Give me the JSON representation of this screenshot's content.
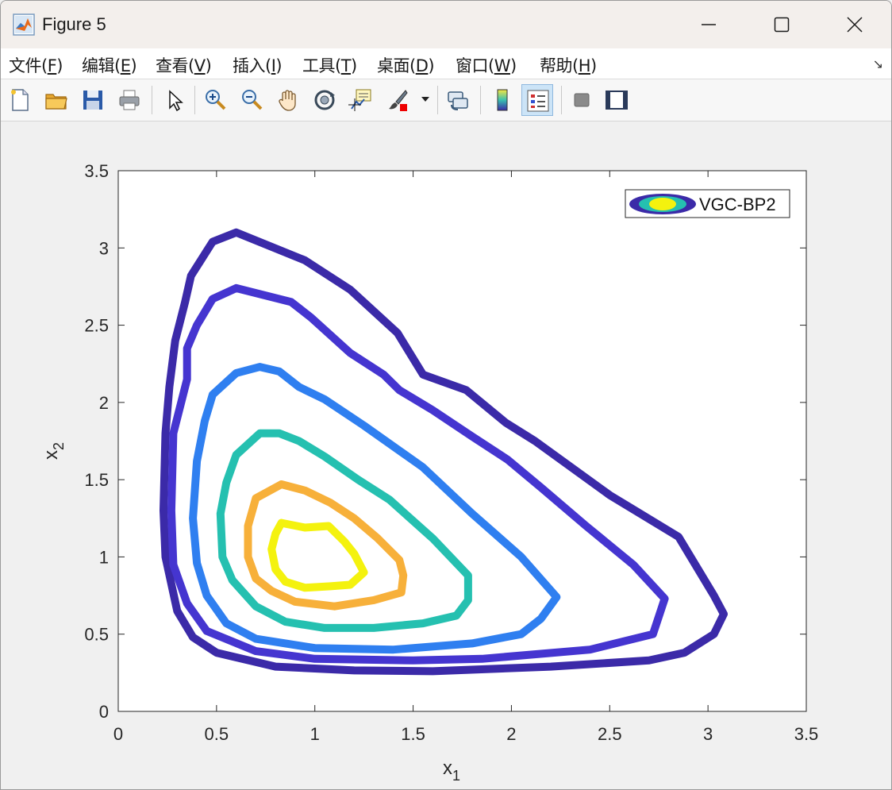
{
  "window": {
    "title": "Figure 5"
  },
  "menu": {
    "items": [
      {
        "label": "文件(",
        "key": "F",
        "tail": ")"
      },
      {
        "label": "编辑(",
        "key": "E",
        "tail": ")"
      },
      {
        "label": "查看(",
        "key": "V",
        "tail": ")"
      },
      {
        "label": "插入(",
        "key": "I",
        "tail": ")"
      },
      {
        "label": "工具(",
        "key": "T",
        "tail": ")"
      },
      {
        "label": "桌面(",
        "key": "D",
        "tail": ")"
      },
      {
        "label": "窗口(",
        "key": "W",
        "tail": ")"
      },
      {
        "label": "帮助(",
        "key": "H",
        "tail": ")"
      }
    ],
    "overflow_glyph": "↘"
  },
  "toolbar": {
    "buttons": [
      "new-figure",
      "open-file",
      "save",
      "print",
      "edit-plot-arrow",
      "zoom-in",
      "zoom-out",
      "pan",
      "rotate-3d",
      "data-cursor",
      "brush",
      "link-plot",
      "colorbar",
      "legend",
      "hide-plot-tools",
      "show-plot-tools"
    ]
  },
  "chart_data": {
    "type": "contour",
    "xlabel": "x",
    "xlabel_sub": "1",
    "ylabel": "x",
    "ylabel_sub": "2",
    "xlim": [
      0,
      3.5
    ],
    "ylim": [
      0,
      3.5
    ],
    "xticks": [
      "0",
      "0.5",
      "1",
      "1.5",
      "2",
      "2.5",
      "3",
      "3.5"
    ],
    "yticks": [
      "0",
      "0.5",
      "1",
      "1.5",
      "2",
      "2.5",
      "3",
      "3.5"
    ],
    "grid": false,
    "legend": {
      "label": "VGC-BP2",
      "placement": "top-right"
    },
    "levels": [
      {
        "color": "#3b2aa8",
        "points": [
          [
            0.6,
            3.1
          ],
          [
            0.95,
            2.92
          ],
          [
            1.18,
            2.73
          ],
          [
            1.42,
            2.45
          ],
          [
            1.55,
            2.18
          ],
          [
            1.77,
            2.08
          ],
          [
            1.97,
            1.87
          ],
          [
            2.12,
            1.75
          ],
          [
            2.5,
            1.4
          ],
          [
            2.85,
            1.13
          ],
          [
            3.03,
            0.75
          ],
          [
            3.08,
            0.63
          ],
          [
            3.03,
            0.5
          ],
          [
            2.88,
            0.38
          ],
          [
            2.7,
            0.33
          ],
          [
            2.2,
            0.29
          ],
          [
            1.6,
            0.26
          ],
          [
            1.2,
            0.265
          ],
          [
            0.8,
            0.29
          ],
          [
            0.5,
            0.38
          ],
          [
            0.38,
            0.48
          ],
          [
            0.3,
            0.65
          ],
          [
            0.24,
            1.0
          ],
          [
            0.23,
            1.3
          ],
          [
            0.24,
            1.8
          ],
          [
            0.26,
            2.1
          ],
          [
            0.29,
            2.4
          ],
          [
            0.34,
            2.65
          ],
          [
            0.37,
            2.82
          ],
          [
            0.48,
            3.04
          ],
          [
            0.6,
            3.1
          ]
        ]
      },
      {
        "color": "#4535d0",
        "points": [
          [
            0.6,
            2.74
          ],
          [
            0.88,
            2.65
          ],
          [
            0.98,
            2.55
          ],
          [
            1.18,
            2.32
          ],
          [
            1.35,
            2.18
          ],
          [
            1.43,
            2.08
          ],
          [
            1.6,
            1.95
          ],
          [
            1.8,
            1.78
          ],
          [
            1.98,
            1.63
          ],
          [
            2.15,
            1.45
          ],
          [
            2.38,
            1.2
          ],
          [
            2.62,
            0.95
          ],
          [
            2.78,
            0.73
          ],
          [
            2.72,
            0.5
          ],
          [
            2.4,
            0.4
          ],
          [
            1.85,
            0.34
          ],
          [
            1.5,
            0.33
          ],
          [
            1.0,
            0.34
          ],
          [
            0.7,
            0.39
          ],
          [
            0.45,
            0.52
          ],
          [
            0.35,
            0.7
          ],
          [
            0.28,
            0.95
          ],
          [
            0.27,
            1.3
          ],
          [
            0.28,
            1.8
          ],
          [
            0.35,
            2.15
          ],
          [
            0.35,
            2.35
          ],
          [
            0.4,
            2.5
          ],
          [
            0.48,
            2.67
          ],
          [
            0.6,
            2.74
          ]
        ]
      },
      {
        "color": "#2f7ff0",
        "points": [
          [
            0.72,
            2.23
          ],
          [
            0.82,
            2.2
          ],
          [
            0.92,
            2.1
          ],
          [
            1.05,
            2.02
          ],
          [
            1.25,
            1.85
          ],
          [
            1.55,
            1.58
          ],
          [
            1.8,
            1.28
          ],
          [
            2.05,
            1.0
          ],
          [
            2.23,
            0.74
          ],
          [
            2.15,
            0.6
          ],
          [
            2.05,
            0.5
          ],
          [
            1.8,
            0.44
          ],
          [
            1.4,
            0.4
          ],
          [
            1.0,
            0.41
          ],
          [
            0.7,
            0.47
          ],
          [
            0.55,
            0.57
          ],
          [
            0.45,
            0.75
          ],
          [
            0.4,
            0.96
          ],
          [
            0.38,
            1.25
          ],
          [
            0.4,
            1.62
          ],
          [
            0.44,
            1.88
          ],
          [
            0.48,
            2.05
          ],
          [
            0.6,
            2.19
          ],
          [
            0.72,
            2.23
          ]
        ]
      },
      {
        "color": "#25c0b0",
        "points": [
          [
            0.72,
            1.8
          ],
          [
            0.82,
            1.8
          ],
          [
            0.92,
            1.75
          ],
          [
            1.05,
            1.65
          ],
          [
            1.22,
            1.5
          ],
          [
            1.38,
            1.37
          ],
          [
            1.6,
            1.12
          ],
          [
            1.78,
            0.88
          ],
          [
            1.78,
            0.72
          ],
          [
            1.72,
            0.62
          ],
          [
            1.55,
            0.57
          ],
          [
            1.3,
            0.54
          ],
          [
            1.05,
            0.54
          ],
          [
            0.85,
            0.58
          ],
          [
            0.7,
            0.68
          ],
          [
            0.58,
            0.85
          ],
          [
            0.53,
            1.0
          ],
          [
            0.52,
            1.28
          ],
          [
            0.55,
            1.48
          ],
          [
            0.6,
            1.66
          ],
          [
            0.72,
            1.8
          ]
        ]
      },
      {
        "color": "#f7b03a",
        "points": [
          [
            0.83,
            1.47
          ],
          [
            0.95,
            1.43
          ],
          [
            1.08,
            1.35
          ],
          [
            1.2,
            1.25
          ],
          [
            1.32,
            1.12
          ],
          [
            1.43,
            0.98
          ],
          [
            1.45,
            0.88
          ],
          [
            1.44,
            0.77
          ],
          [
            1.3,
            0.72
          ],
          [
            1.1,
            0.68
          ],
          [
            0.9,
            0.71
          ],
          [
            0.78,
            0.78
          ],
          [
            0.7,
            0.86
          ],
          [
            0.66,
            1.0
          ],
          [
            0.66,
            1.2
          ],
          [
            0.7,
            1.38
          ],
          [
            0.83,
            1.47
          ]
        ]
      },
      {
        "color": "#f4f20e",
        "points": [
          [
            0.83,
            1.22
          ],
          [
            0.95,
            1.19
          ],
          [
            1.07,
            1.2
          ],
          [
            1.15,
            1.1
          ],
          [
            1.2,
            1.02
          ],
          [
            1.25,
            0.9
          ],
          [
            1.18,
            0.82
          ],
          [
            1.08,
            0.81
          ],
          [
            0.95,
            0.8
          ],
          [
            0.85,
            0.84
          ],
          [
            0.8,
            0.92
          ],
          [
            0.78,
            1.05
          ],
          [
            0.8,
            1.15
          ],
          [
            0.83,
            1.22
          ]
        ]
      }
    ]
  }
}
